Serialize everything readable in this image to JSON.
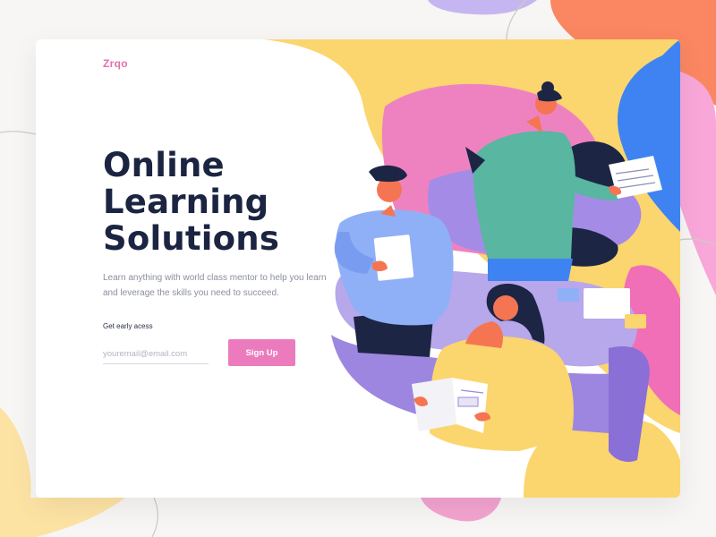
{
  "brand": {
    "logo_text": "Zrqo"
  },
  "hero": {
    "headline_lines": [
      "Online",
      "Learning",
      "Solutions"
    ],
    "description": "Learn anything with world class mentor to help you learn and leverage the skills you need to succeed."
  },
  "signup": {
    "label": "Get early acess",
    "email_placeholder": "youremail@email.com",
    "button_label": "Sign Up"
  },
  "colors": {
    "brand_pink": "#e36fae",
    "button_pink": "#eb7bbd",
    "headline_navy": "#1b2441",
    "blob_yellow": "#fbd56e",
    "blob_blue": "#3f83f3",
    "blob_pink": "#ee82c1",
    "blob_purple": "#b7a7eb",
    "blob_coral": "#fa8057"
  },
  "illustration": {
    "subject": "three students studying with books and papers inside colorful abstract shapes"
  }
}
